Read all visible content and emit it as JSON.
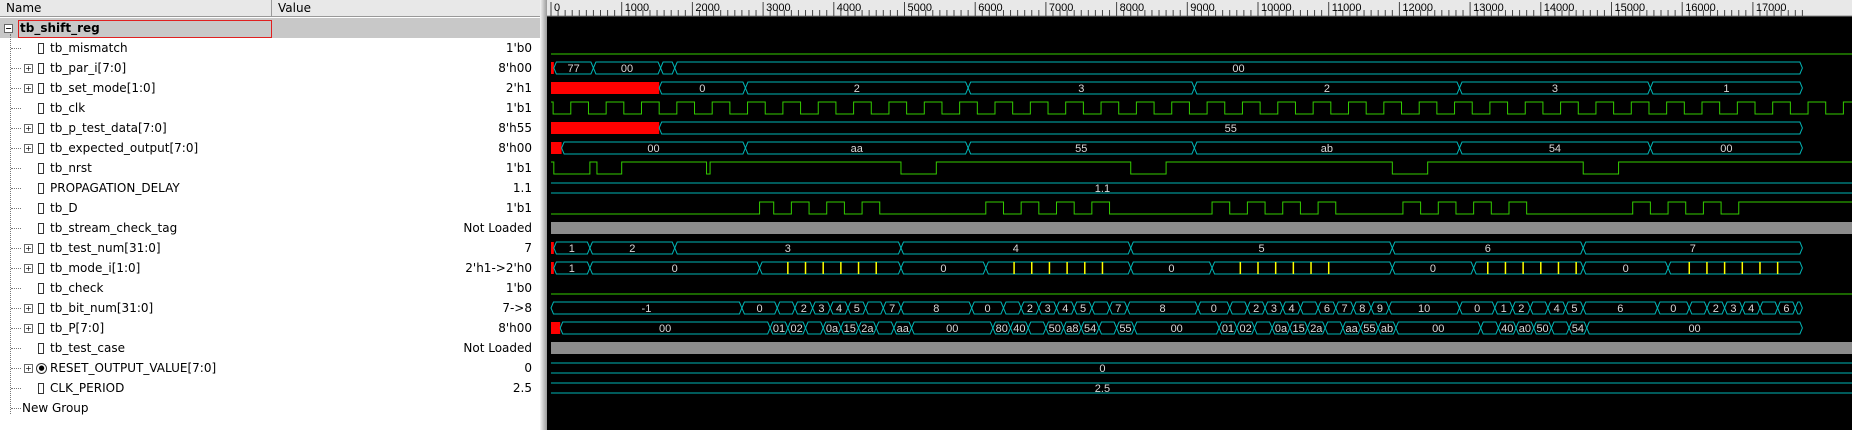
{
  "columns": {
    "name": "Name",
    "value": "Value"
  },
  "scope": {
    "label": "tb_shift_reg"
  },
  "signals": [
    {
      "label": "tb_mismatch",
      "value": "1'b0",
      "kind": "bit",
      "expand": false
    },
    {
      "label": "tb_par_i[7:0]",
      "value": "8'h00",
      "kind": "bus",
      "expand": true
    },
    {
      "label": "tb_set_mode[1:0]",
      "value": "2'h1",
      "kind": "bus",
      "expand": true
    },
    {
      "label": "tb_clk",
      "value": "1'b1",
      "kind": "bit",
      "expand": false
    },
    {
      "label": "tb_p_test_data[7:0]",
      "value": "8'h55",
      "kind": "bus",
      "expand": true
    },
    {
      "label": "tb_expected_output[7:0]",
      "value": "8'h00",
      "kind": "bus",
      "expand": true
    },
    {
      "label": "tb_nrst",
      "value": "1'b1",
      "kind": "bit",
      "expand": false
    },
    {
      "label": "PROPAGATION_DELAY",
      "value": "1.1",
      "kind": "bit",
      "expand": false
    },
    {
      "label": "tb_D",
      "value": "1'b1",
      "kind": "bit",
      "expand": false
    },
    {
      "label": "tb_stream_check_tag",
      "value": "Not Loaded",
      "kind": "bit",
      "expand": false
    },
    {
      "label": "tb_test_num[31:0]",
      "value": "7",
      "kind": "bus",
      "expand": true
    },
    {
      "label": "tb_mode_i[1:0]",
      "value": "2'h1->2'h0",
      "kind": "bus",
      "expand": true
    },
    {
      "label": "tb_check",
      "value": "1'b0",
      "kind": "bit",
      "expand": false
    },
    {
      "label": "tb_bit_num[31:0]",
      "value": "7->8",
      "kind": "bus",
      "expand": true
    },
    {
      "label": "tb_P[7:0]",
      "value": "8'h00",
      "kind": "bus",
      "expand": true
    },
    {
      "label": "tb_test_case",
      "value": "Not Loaded",
      "kind": "bit",
      "expand": false
    },
    {
      "label": "RESET_OUTPUT_VALUE[7:0]",
      "value": "0",
      "kind": "param",
      "expand": true
    },
    {
      "label": "CLK_PERIOD",
      "value": "2.5",
      "kind": "bit",
      "expand": false
    }
  ],
  "group": {
    "label": "New Group"
  },
  "ruler": {
    "ticks": [
      0,
      1000,
      2000,
      3000,
      4000,
      5000,
      6000,
      7000,
      8000,
      9000,
      10000,
      11000,
      12000,
      13000,
      14000,
      15000,
      16000,
      17000
    ],
    "tick_labels": [
      "0",
      "1000",
      "2000",
      "3000",
      "4000",
      "5000",
      "6000",
      "7000",
      "8000",
      "9000",
      "10000",
      "11000",
      "12000",
      "13000",
      "14000",
      "15000",
      "16000",
      "17000"
    ],
    "end": 17700
  },
  "waves": [
    {
      "type": "digital",
      "init": 0,
      "edges": []
    },
    {
      "type": "bus",
      "segs": [
        [
          0,
          40,
          "",
          "x"
        ],
        [
          40,
          600,
          "77",
          ""
        ],
        [
          600,
          1550,
          "00",
          ""
        ],
        [
          1550,
          1750,
          "",
          ""
        ],
        [
          1750,
          17700,
          "00",
          ""
        ]
      ]
    },
    {
      "type": "bus",
      "segs": [
        [
          0,
          1530,
          "",
          "x"
        ],
        [
          1530,
          2750,
          "0",
          ""
        ],
        [
          2750,
          5900,
          "2",
          ""
        ],
        [
          5900,
          9100,
          "3",
          ""
        ],
        [
          9100,
          12850,
          "2",
          ""
        ],
        [
          12850,
          15550,
          "3",
          ""
        ],
        [
          15550,
          17700,
          "1",
          ""
        ]
      ]
    },
    {
      "type": "clock",
      "start": 30,
      "period": 250,
      "first": 1
    },
    {
      "type": "bus",
      "segs": [
        [
          0,
          1530,
          "",
          "x"
        ],
        [
          1530,
          17700,
          "55",
          ""
        ]
      ]
    },
    {
      "type": "bus",
      "segs": [
        [
          0,
          150,
          "",
          "x"
        ],
        [
          150,
          2750,
          "00",
          ""
        ],
        [
          2750,
          5900,
          "aa",
          ""
        ],
        [
          5900,
          9100,
          "55",
          ""
        ],
        [
          9100,
          12850,
          "ab",
          ""
        ],
        [
          12850,
          15550,
          "54",
          ""
        ],
        [
          15550,
          17700,
          "00",
          ""
        ]
      ]
    },
    {
      "type": "digital",
      "init": 1,
      "edges": [
        [
          40,
          0
        ],
        [
          550,
          1
        ],
        [
          650,
          0
        ],
        [
          1000,
          1
        ],
        [
          2200,
          0
        ],
        [
          2250,
          1
        ],
        [
          2700,
          1
        ],
        [
          4950,
          0
        ],
        [
          5450,
          1
        ],
        [
          8200,
          0
        ],
        [
          8700,
          1
        ],
        [
          11900,
          0
        ],
        [
          12400,
          1
        ],
        [
          14600,
          0
        ],
        [
          15100,
          1
        ]
      ]
    },
    {
      "type": "const",
      "label": "1.1"
    },
    {
      "type": "digital",
      "init": 0,
      "edges": [
        [
          2950,
          1
        ],
        [
          3150,
          0
        ],
        [
          3400,
          1
        ],
        [
          3650,
          0
        ],
        [
          3900,
          1
        ],
        [
          4150,
          0
        ],
        [
          4400,
          1
        ],
        [
          4650,
          0
        ],
        [
          6150,
          1
        ],
        [
          6400,
          0
        ],
        [
          6650,
          1
        ],
        [
          6900,
          0
        ],
        [
          7150,
          1
        ],
        [
          7400,
          0
        ],
        [
          7650,
          1
        ],
        [
          7900,
          0
        ],
        [
          9350,
          1
        ],
        [
          9600,
          0
        ],
        [
          9850,
          1
        ],
        [
          10100,
          0
        ],
        [
          10350,
          1
        ],
        [
          10600,
          0
        ],
        [
          10850,
          1
        ],
        [
          11100,
          0
        ],
        [
          12050,
          1
        ],
        [
          12300,
          0
        ],
        [
          12550,
          1
        ],
        [
          12800,
          0
        ],
        [
          13050,
          1
        ],
        [
          13300,
          0
        ],
        [
          13550,
          1
        ],
        [
          13800,
          0
        ],
        [
          15300,
          1
        ],
        [
          15550,
          0
        ],
        [
          15800,
          1
        ],
        [
          16050,
          0
        ],
        [
          16300,
          1
        ],
        [
          16550,
          0
        ],
        [
          16800,
          1
        ],
        [
          17700,
          1
        ]
      ]
    },
    {
      "type": "grey"
    },
    {
      "type": "bus",
      "segs": [
        [
          0,
          40,
          "",
          "x"
        ],
        [
          40,
          550,
          "1",
          ""
        ],
        [
          550,
          1750,
          "2",
          ""
        ],
        [
          1750,
          4950,
          "3",
          ""
        ],
        [
          4950,
          8200,
          "4",
          ""
        ],
        [
          8200,
          11900,
          "5",
          ""
        ],
        [
          11900,
          14600,
          "6",
          ""
        ],
        [
          14600,
          17700,
          "7",
          ""
        ]
      ]
    },
    {
      "type": "bus",
      "segs": [
        [
          0,
          40,
          "",
          "x"
        ],
        [
          40,
          550,
          "1",
          ""
        ],
        [
          550,
          2950,
          "0",
          ""
        ],
        [
          2950,
          4950,
          "",
          ""
        ],
        [
          4950,
          6150,
          "0",
          ""
        ],
        [
          6150,
          8200,
          "",
          ""
        ],
        [
          8200,
          9350,
          "0",
          ""
        ],
        [
          9350,
          11900,
          "",
          ""
        ],
        [
          11900,
          13050,
          "0",
          ""
        ],
        [
          13050,
          14600,
          "",
          ""
        ],
        [
          14600,
          15800,
          "0",
          ""
        ],
        [
          15800,
          17700,
          "",
          ""
        ]
      ],
      "yellow": [
        3350,
        3600,
        3850,
        4100,
        4350,
        4600,
        6550,
        6800,
        7050,
        7300,
        7550,
        7800,
        9750,
        10000,
        10250,
        10500,
        10750,
        11000,
        13250,
        13500,
        13750,
        14000,
        14250,
        14500,
        16100,
        16350,
        16600,
        16850,
        17100,
        17350
      ]
    },
    {
      "type": "digital",
      "init": 0,
      "edges": []
    },
    {
      "type": "bus",
      "segs": [
        [
          0,
          2700,
          "-1",
          ""
        ],
        [
          2700,
          3200,
          "0",
          ""
        ],
        [
          3200,
          3450,
          "",
          ""
        ],
        [
          3450,
          3700,
          "2",
          ""
        ],
        [
          3700,
          3950,
          "3",
          ""
        ],
        [
          3950,
          4200,
          "4",
          ""
        ],
        [
          4200,
          4450,
          "5",
          ""
        ],
        [
          4450,
          4700,
          "",
          ""
        ],
        [
          4700,
          4950,
          "7",
          ""
        ],
        [
          4950,
          5950,
          "8",
          ""
        ],
        [
          5950,
          6400,
          "0",
          ""
        ],
        [
          6400,
          6650,
          "",
          ""
        ],
        [
          6650,
          6900,
          "2",
          ""
        ],
        [
          6900,
          7150,
          "3",
          ""
        ],
        [
          7150,
          7400,
          "4",
          ""
        ],
        [
          7400,
          7650,
          "5",
          ""
        ],
        [
          7650,
          7900,
          "",
          ""
        ],
        [
          7900,
          8150,
          "7",
          ""
        ],
        [
          8150,
          9150,
          "8",
          ""
        ],
        [
          9150,
          9600,
          "0",
          ""
        ],
        [
          9600,
          9850,
          "",
          ""
        ],
        [
          9850,
          10100,
          "2",
          ""
        ],
        [
          10100,
          10350,
          "3",
          ""
        ],
        [
          10350,
          10600,
          "4",
          ""
        ],
        [
          10600,
          10850,
          "",
          ""
        ],
        [
          10850,
          11100,
          "6",
          ""
        ],
        [
          11100,
          11350,
          "7",
          ""
        ],
        [
          11350,
          11600,
          "8",
          ""
        ],
        [
          11600,
          11850,
          "9",
          ""
        ],
        [
          11850,
          12850,
          "10",
          ""
        ],
        [
          12850,
          13350,
          "0",
          ""
        ],
        [
          13350,
          13600,
          "1",
          ""
        ],
        [
          13600,
          13850,
          "2",
          ""
        ],
        [
          13850,
          14100,
          "",
          ""
        ],
        [
          14100,
          14350,
          "4",
          ""
        ],
        [
          14350,
          14600,
          "5",
          ""
        ],
        [
          14600,
          15650,
          "6",
          ""
        ],
        [
          15650,
          16100,
          "0",
          ""
        ],
        [
          16100,
          16350,
          "",
          ""
        ],
        [
          16350,
          16600,
          "2",
          ""
        ],
        [
          16600,
          16850,
          "3",
          ""
        ],
        [
          16850,
          17100,
          "4",
          ""
        ],
        [
          17100,
          17350,
          "",
          ""
        ],
        [
          17350,
          17600,
          "6",
          ""
        ],
        [
          17600,
          17700,
          "7",
          ""
        ]
      ]
    },
    {
      "type": "bus",
      "segs": [
        [
          0,
          130,
          "",
          "x"
        ],
        [
          130,
          3100,
          "00",
          ""
        ],
        [
          3100,
          3350,
          "01",
          ""
        ],
        [
          3350,
          3600,
          "02",
          ""
        ],
        [
          3600,
          3850,
          "",
          ""
        ],
        [
          3850,
          4100,
          "0a",
          ""
        ],
        [
          4100,
          4350,
          "15",
          ""
        ],
        [
          4350,
          4600,
          "2a",
          ""
        ],
        [
          4600,
          4850,
          "",
          ""
        ],
        [
          4850,
          5100,
          "aa",
          ""
        ],
        [
          5100,
          6250,
          "00",
          ""
        ],
        [
          6250,
          6500,
          "80",
          ""
        ],
        [
          6500,
          6750,
          "40",
          ""
        ],
        [
          6750,
          7000,
          "",
          ""
        ],
        [
          7000,
          7250,
          "50",
          ""
        ],
        [
          7250,
          7500,
          "a8",
          ""
        ],
        [
          7500,
          7750,
          "54",
          ""
        ],
        [
          7750,
          8000,
          "",
          ""
        ],
        [
          8000,
          8250,
          "55",
          ""
        ],
        [
          8250,
          9450,
          "00",
          ""
        ],
        [
          9450,
          9700,
          "01",
          ""
        ],
        [
          9700,
          9950,
          "02",
          ""
        ],
        [
          9950,
          10200,
          "",
          ""
        ],
        [
          10200,
          10450,
          "0a",
          ""
        ],
        [
          10450,
          10700,
          "15",
          ""
        ],
        [
          10700,
          10950,
          "2a",
          ""
        ],
        [
          10950,
          11200,
          "",
          ""
        ],
        [
          11200,
          11450,
          "aa",
          ""
        ],
        [
          11450,
          11700,
          "55",
          ""
        ],
        [
          11700,
          11950,
          "ab",
          ""
        ],
        [
          11950,
          13150,
          "00",
          ""
        ],
        [
          13150,
          13400,
          "",
          ""
        ],
        [
          13400,
          13650,
          "40",
          ""
        ],
        [
          13650,
          13900,
          "a0",
          ""
        ],
        [
          13900,
          14150,
          "50",
          ""
        ],
        [
          14150,
          14400,
          "",
          ""
        ],
        [
          14400,
          14650,
          "54",
          ""
        ],
        [
          14650,
          17700,
          "00",
          ""
        ]
      ]
    },
    {
      "type": "grey"
    },
    {
      "type": "const",
      "label": "0"
    },
    {
      "type": "const",
      "label": "2.5"
    }
  ],
  "colors": {
    "green": "#33cc00",
    "cyan": "#00b3b3",
    "red": "#ff0000",
    "grey": "#8c8c8c",
    "yellow": "#ffff00",
    "label": "#d8d8d8"
  }
}
